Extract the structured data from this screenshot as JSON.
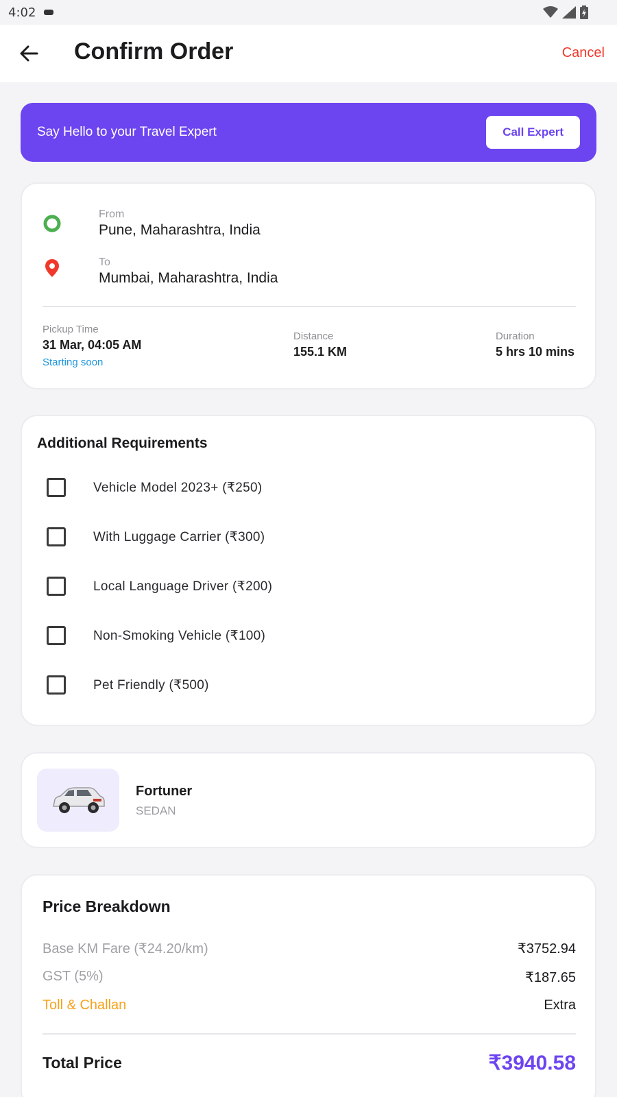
{
  "status_bar": {
    "time": "4:02"
  },
  "header": {
    "title": "Confirm Order",
    "cancel_label": "Cancel"
  },
  "banner": {
    "text": "Say Hello to your Travel Expert",
    "button_label": "Call Expert"
  },
  "route": {
    "from_label": "From",
    "from_value": "Pune, Maharashtra, India",
    "to_label": "To",
    "to_value": "Mumbai, Maharashtra, India",
    "pickup_label": "Pickup Time",
    "pickup_value": "31 Mar, 04:05 AM",
    "pickup_note": "Starting soon",
    "distance_label": "Distance",
    "distance_value": "155.1 KM",
    "duration_label": "Duration",
    "duration_value": "5 hrs 10 mins"
  },
  "requirements": {
    "heading": "Additional Requirements",
    "items": [
      {
        "label": "Vehicle Model 2023+ (₹250)",
        "checked": false
      },
      {
        "label": "With Luggage Carrier (₹300)",
        "checked": false
      },
      {
        "label": "Local Language Driver (₹200)",
        "checked": false
      },
      {
        "label": "Non-Smoking Vehicle (₹100)",
        "checked": false
      },
      {
        "label": "Pet Friendly (₹500)",
        "checked": false
      }
    ]
  },
  "vehicle": {
    "name": "Fortuner",
    "type": "SEDAN"
  },
  "price": {
    "heading": "Price Breakdown",
    "rows": [
      {
        "label": "Base KM Fare (₹24.20/km)",
        "value": "₹3752.94"
      },
      {
        "label": "GST (5%)",
        "value": "₹187.65"
      },
      {
        "label": "Toll & Challan",
        "value": "Extra"
      }
    ],
    "total_label": "Total Price",
    "total_value": "₹3940.58"
  },
  "colors": {
    "accent": "#6c44f0",
    "danger": "#f0392b",
    "toll": "#f7a21b",
    "link": "#1e96dc",
    "from_dot": "#4caf50",
    "to_pin": "#f0392b"
  },
  "icons": [
    "back-arrow-icon",
    "wifi-icon",
    "signal-icon",
    "battery-icon",
    "origin-circle-icon",
    "location-pin-icon",
    "car-image"
  ]
}
